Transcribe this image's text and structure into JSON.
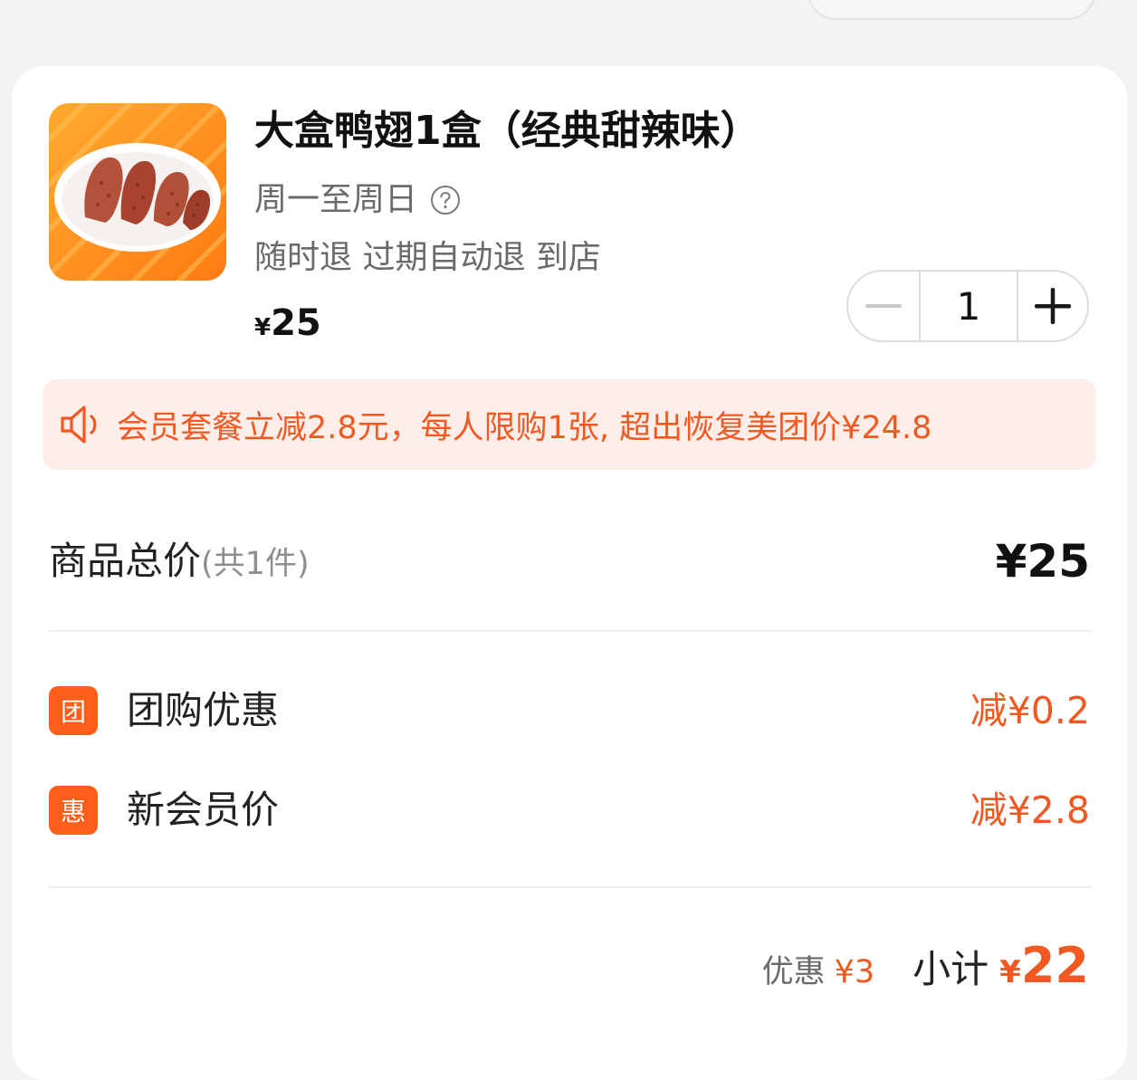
{
  "product": {
    "image_icon": "duck-wings-photo",
    "title": "大盒鸭翅1盒（经典甜辣味）",
    "availability": "周一至周日",
    "help_icon": "question-circle-icon",
    "policies": "随时退 过期自动退 到店",
    "currency": "¥",
    "price": "25",
    "quantity": "1",
    "minus_icon": "minus-icon",
    "plus_icon": "plus-icon"
  },
  "promo": {
    "icon": "speaker-icon",
    "text": "会员套餐立减2.8元，每人限购1张, 超出恢复美团价¥24.8"
  },
  "totals": {
    "label": "商品总价",
    "count": "(共1件)",
    "value": "¥25"
  },
  "discounts": [
    {
      "badge": "团",
      "name": "团购优惠",
      "value": "减¥0.2"
    },
    {
      "badge": "惠",
      "name": "新会员价",
      "value": "减¥2.8"
    }
  ],
  "summary": {
    "discount_label": "优惠",
    "discount_value": "¥3",
    "subtotal_label": "小计",
    "currency": "¥",
    "subtotal_value": "22"
  },
  "colors": {
    "accent": "#f05a22",
    "badge": "#ff5d1a",
    "promo_bg": "#fdeeea",
    "page_bg": "#f3f3f3",
    "card_bg": "#ffffff"
  }
}
